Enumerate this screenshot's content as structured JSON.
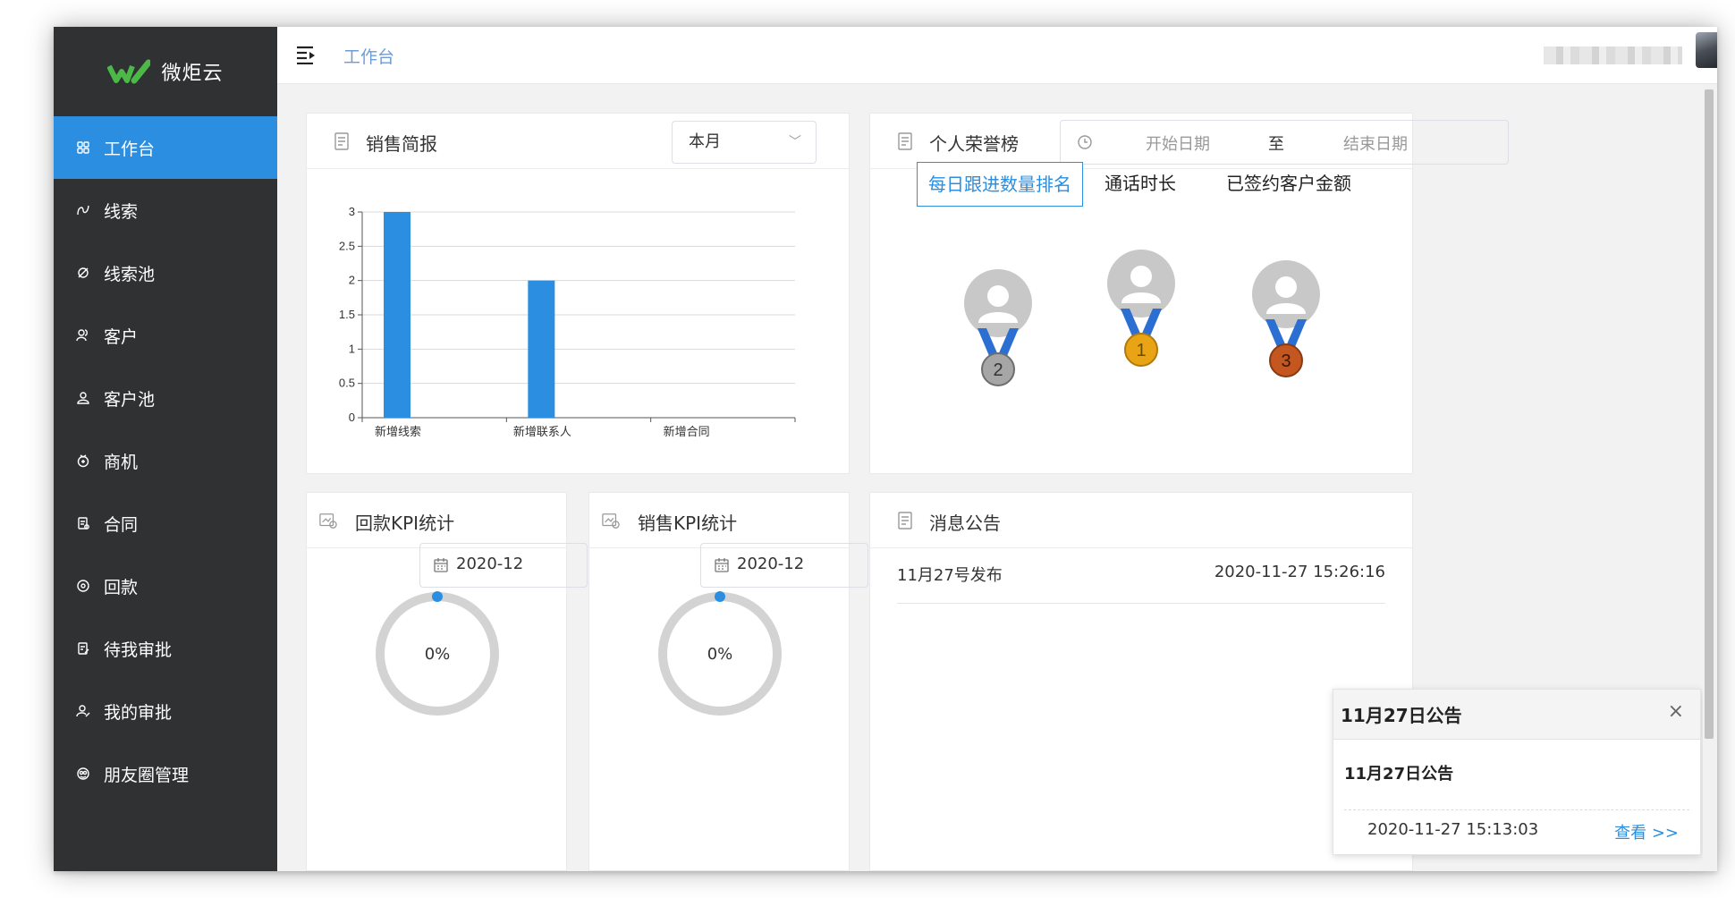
{
  "app": {
    "name": "微炬云",
    "brand_color": "#2b8ee0",
    "sidebar_bg": "#303133",
    "logo_green": "#4cb848"
  },
  "sidebar": {
    "items": [
      {
        "label": "工作台",
        "icon": "dashboard-icon",
        "active": true
      },
      {
        "label": "线索",
        "icon": "leads-icon",
        "active": false
      },
      {
        "label": "线索池",
        "icon": "leads-pool-icon",
        "active": false
      },
      {
        "label": "客户",
        "icon": "customer-icon",
        "active": false
      },
      {
        "label": "客户池",
        "icon": "customer-pool-icon",
        "active": false
      },
      {
        "label": "商机",
        "icon": "opportunity-icon",
        "active": false
      },
      {
        "label": "合同",
        "icon": "contract-icon",
        "active": false
      },
      {
        "label": "回款",
        "icon": "payment-icon",
        "active": false
      },
      {
        "label": "待我审批",
        "icon": "pending-approval-icon",
        "active": false
      },
      {
        "label": "我的审批",
        "icon": "my-approval-icon",
        "active": false
      },
      {
        "label": "朋友圈管理",
        "icon": "moments-icon",
        "active": false
      }
    ]
  },
  "header": {
    "breadcrumb": "工作台",
    "user_avatar": "user-avatar"
  },
  "sales_report": {
    "title": "销售简报",
    "period": "本月",
    "chart_data": {
      "type": "bar",
      "categories": [
        "新增线索",
        "新增联系人",
        "新增合同"
      ],
      "values": [
        3,
        2,
        0
      ],
      "ylim": [
        0,
        3
      ],
      "yticks": [
        "0",
        "0.5",
        "1",
        "1.5",
        "2",
        "2.5",
        "3"
      ],
      "grid": true,
      "bar_color": "#2b8ee0"
    }
  },
  "honor_board": {
    "title": "个人荣誉榜",
    "date_start_placeholder": "开始日期",
    "date_separator": "至",
    "date_end_placeholder": "结束日期",
    "tabs": [
      {
        "label": "每日跟进数量排名",
        "active": true
      },
      {
        "label": "通话时长",
        "active": false
      },
      {
        "label": "已签约客户金额",
        "active": false
      }
    ],
    "ranks": [
      "2",
      "1",
      "3"
    ]
  },
  "payment_kpi": {
    "title": "回款KPI统计",
    "month": "2020-12",
    "percent": "0%",
    "progress": 0
  },
  "sales_kpi": {
    "title": "销售KPI统计",
    "month": "2020-12",
    "percent": "0%",
    "progress": 0
  },
  "notices": {
    "title": "消息公告",
    "items": [
      {
        "title": "11月27号发布",
        "time": "2020-11-27 15:26:16"
      }
    ]
  },
  "notice_popup": {
    "title": "11月27日公告",
    "subject": "11月27日公告",
    "time": "2020-11-27 15:13:03",
    "link": "查看 >>",
    "close": "×"
  }
}
